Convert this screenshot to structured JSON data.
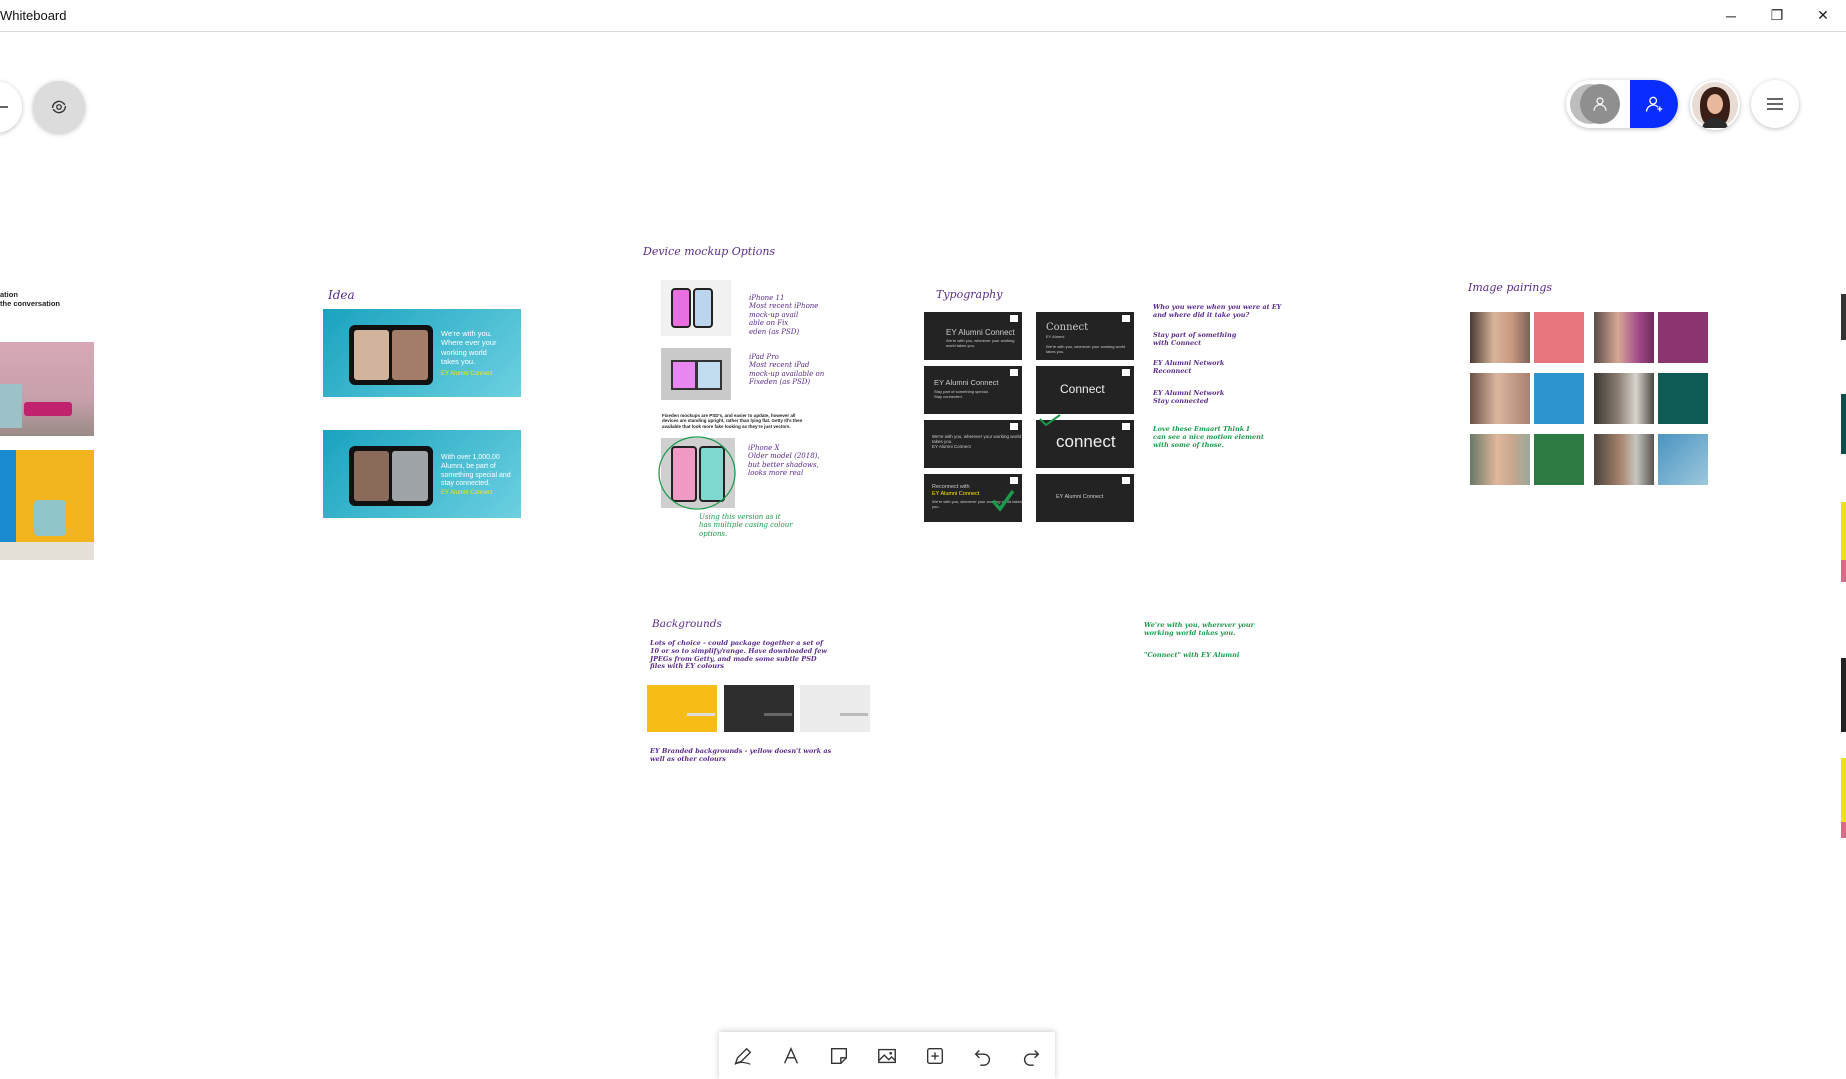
{
  "window": {
    "title": "Whiteboard",
    "controls": {
      "minimize": "─",
      "restore": "❐",
      "close": "✕"
    }
  },
  "colors": {
    "accent_blue": "#0a2dff",
    "handwriting_purple": "#5a2b8c",
    "handwriting_green": "#1a9a4b",
    "ey_yellow": "#ffe600",
    "card_dark": "#232323"
  },
  "left_note": {
    "line1": "ation",
    "line2": "the conversation"
  },
  "idea": {
    "heading": "Idea",
    "slide1_text": "We're with you.\nWhere ever your\nworking world\ntakes you.",
    "slide1_brand": "EY Alumni Connect",
    "slide2_text": "With over 1,000,00\nAlumni, be part of\nsomething special and\nstay connected.",
    "slide2_brand": "EY Alumni Connect"
  },
  "device_mockup": {
    "heading": "Device mockup Options",
    "iphone11_note": "iPhone 11\nMost recent iPhone\nmock-up avail\nable on Fix\neden (as PSD)",
    "ipad_note": "iPad Pro\nMost recent iPad\nmock-up available on\nFixeden (as PSD)",
    "small_note": "Fixeden mockups are PSD's, and easier to update, however all devices are standing upright, rather than lying flat. Getty Ill's then available that look more fake looking as they're just vectors.",
    "iphonex_note": "iPhone X\nOlder model (2018),\nbut better shadows,\nlooks more real",
    "choice_note": "Using this version as it\nhas multiple casing colour\noptions."
  },
  "typography": {
    "heading": "Typography",
    "cards": [
      {
        "title": "EY Alumni Connect",
        "body": "We're with you, wherever your working world takes you."
      },
      {
        "title": "Connect",
        "body": "EY Alumni\n\nWe're with you, wherever your working world takes you."
      },
      {
        "title": "EY Alumni Connect",
        "body": "Stay part of something special.\nStay connected."
      },
      {
        "title": "Connect",
        "body": ""
      },
      {
        "title": "",
        "body": "We're with you, wherever your working world takes you.\nEY Alumni Connect"
      },
      {
        "title": "connect",
        "body": ""
      },
      {
        "title": "Reconnect with",
        "brand": "EY Alumni Connect",
        "body": "We're with you, wherever your working world takes you."
      },
      {
        "title": "EY Alumni Connect",
        "body": ""
      }
    ],
    "notes": {
      "n1": "Who you were when you were at EY\nand where did it take you?",
      "n2": "Stay part of something\nwith Connect",
      "n3": "EY Alumni Network\nReconnect",
      "n4": "EY Alumni Network\nStay connected",
      "n5": "Love these Emaart Think I\ncan see a nice motion element\nwith some of those."
    }
  },
  "image_pairings": {
    "heading": "Image pairings"
  },
  "backgrounds": {
    "heading": "Backgrounds",
    "note1": "Lots of choice - could package together a set of\n10 or so to simplify/range. Have downloaded few\nJPEGs from Getty, and made some subtle PSD\nfiles with EY colours",
    "note2": "EY Branded backgrounds - yellow doesn't work as\nwell as other colours"
  },
  "tagline_notes": {
    "line1": "We're with you, wherever your\nworking world takes you.",
    "line2": "\"Connect\" with EY Alumni"
  },
  "toolbar": {
    "tools": [
      "pen-icon",
      "text-icon",
      "sticky-note-icon",
      "image-icon",
      "add-icon",
      "undo-icon",
      "redo-icon"
    ]
  }
}
